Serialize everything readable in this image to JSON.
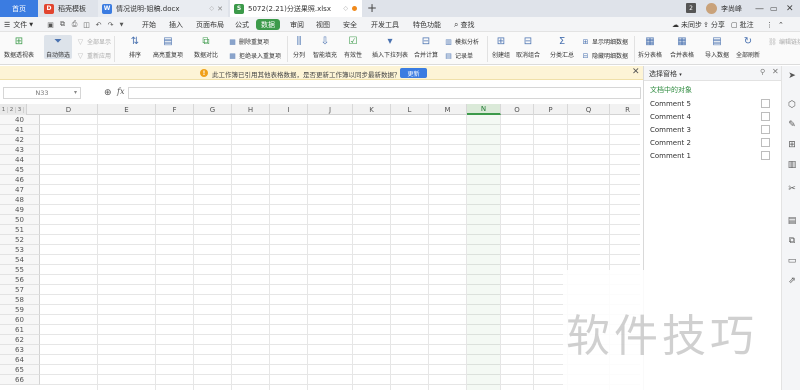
{
  "tabs": {
    "home": "首页",
    "shell": "稻壳模板",
    "doc": "情况说明-姐稿.docx",
    "xls": "5072(2.21)分送果照.xlsx",
    "badge": "2",
    "username": "李尚峰"
  },
  "menu": {
    "file": "文件",
    "items": [
      "开始",
      "插入",
      "页面布局",
      "公式",
      "数据",
      "审阅",
      "视图",
      "安全",
      "开发工具",
      "特色功能"
    ],
    "search": "查找",
    "sync": "未同步",
    "share": "分享",
    "comment": "批注"
  },
  "ribbon": {
    "pivot": "数据透视表",
    "autofilter": "自动筛选",
    "showall": "全部显示",
    "reapply": "重新应用",
    "sort": "排序",
    "highlight_dup": "高亮重复项",
    "compare": "数据对比",
    "remove_dup": "删除重复项",
    "reject_dup": "拒绝录入重复项",
    "split": "分列",
    "smartfill": "智能填充",
    "validity": "有效性",
    "dropdown": "插入下拉列表",
    "consolidate": "合并计算",
    "simulate": "模拟分析",
    "record": "记录单",
    "group": "创建组",
    "ungroup": "取消组合",
    "subtotal": "分类汇总",
    "showdetail": "显示明细数据",
    "hidedetail": "隐藏明细数据",
    "splittable": "拆分表格",
    "mergetable": "合并表格",
    "import": "导入数据",
    "refreshall": "全部刷新",
    "editlinks": "编辑链接"
  },
  "notice": {
    "text": "此工作簿已引用其他表格数据，是否更新工作簿以同步最新数据？",
    "button": "更新"
  },
  "formula": {
    "namebox": "N33",
    "fx": "fx"
  },
  "grid": {
    "columns": [
      "D",
      "E",
      "F",
      "G",
      "H",
      "I",
      "J",
      "K",
      "L",
      "M",
      "N",
      "O",
      "P",
      "Q",
      "R"
    ],
    "selected_column": "N",
    "rows": [
      "40",
      "41",
      "42",
      "43",
      "44",
      "45",
      "46",
      "47",
      "48",
      "49",
      "50",
      "51",
      "52",
      "53",
      "54",
      "55",
      "56",
      "57",
      "58",
      "59",
      "60",
      "61",
      "62",
      "63",
      "64",
      "65",
      "66"
    ],
    "outline_levels": [
      "1",
      "2",
      "3"
    ]
  },
  "pane": {
    "title": "选择窗格",
    "subtitle": "文档中的对象",
    "objects": [
      "Comment 5",
      "Comment 4",
      "Comment 3",
      "Comment 2",
      "Comment 1"
    ]
  },
  "watermark": "软件技巧"
}
